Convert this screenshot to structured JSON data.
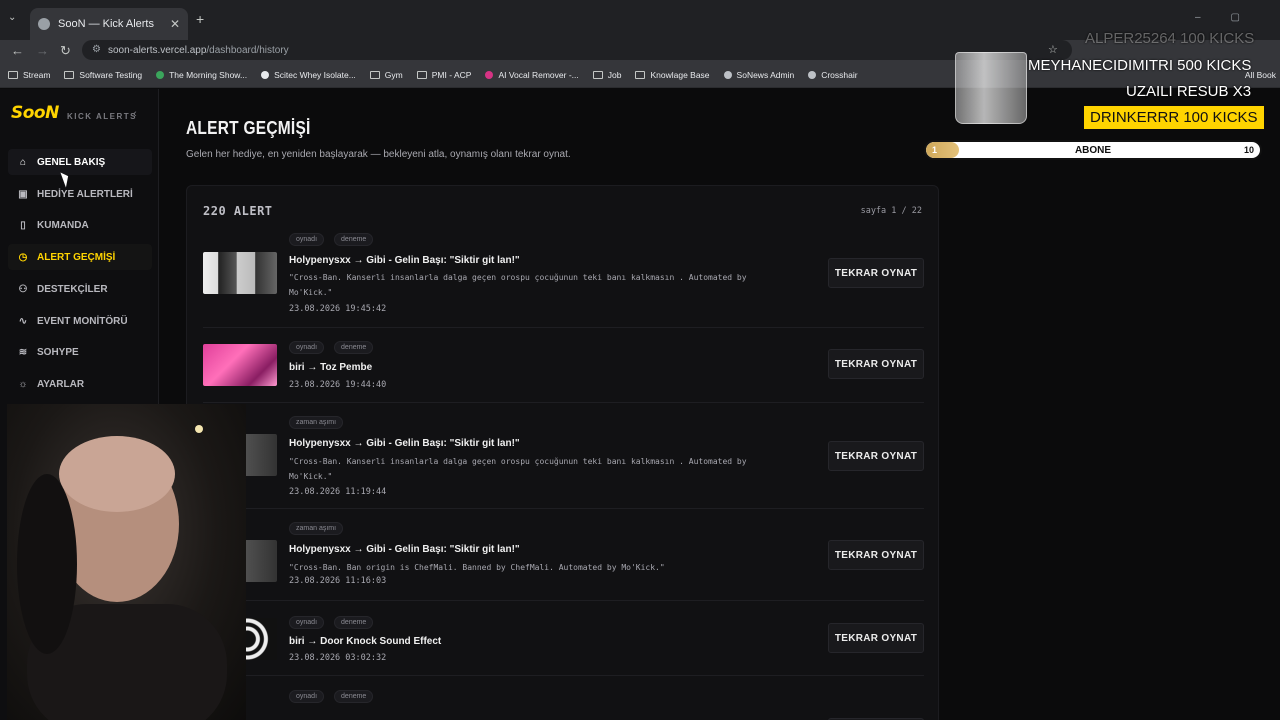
{
  "browser": {
    "tab_title": "SooN — Kick Alerts",
    "url_host": "soon-alerts.vercel.app",
    "url_path": "/dashboard/history",
    "bookmarks": [
      "Stream",
      "Software Testing",
      "The Morning Show...",
      "Scitec Whey Isolate...",
      "Gym",
      "PMI - ACP",
      "AI Vocal Remover -...",
      "Job",
      "Knowlage Base",
      "SoNews Admin",
      "Crosshair"
    ],
    "all_bookmarks": "All Book"
  },
  "sidebar": {
    "logo": "SooN",
    "logo_sub": "KICK ALERTS",
    "items": [
      {
        "label": "GENEL BAKIŞ",
        "icon": "home-icon"
      },
      {
        "label": "HEDİYE ALERTLERİ",
        "icon": "gift-icon"
      },
      {
        "label": "KUMANDA",
        "icon": "remote-icon"
      },
      {
        "label": "ALERT GEÇMİŞİ",
        "icon": "history-icon"
      },
      {
        "label": "DESTEKÇİLER",
        "icon": "supporters-icon"
      },
      {
        "label": "EVENT MONİTÖRÜ",
        "icon": "pulse-icon"
      },
      {
        "label": "SOHYPE",
        "icon": "layers-icon"
      },
      {
        "label": "AYARLAR",
        "icon": "gear-icon"
      }
    ]
  },
  "page": {
    "title": "ALERT GEÇMİŞİ",
    "subtitle": "Gelen her hediye, en yeniden başlayarak — bekleyeni atla, oynamış olanı tekrar oynat.",
    "count": "220 ALERT",
    "pagination": "sayfa 1 / 22",
    "replay_label": "TEKRAR OYNAT"
  },
  "alerts": [
    {
      "tags": [
        "oynadı",
        "deneme"
      ],
      "title": "Holypenysxx → Gibi - Gelin Başı: \"Siktir git lan!\"",
      "message": "\"Cross-Ban. Kanserli insanlarla dalga geçen orospu çocuğunun teki banı kalkmasın . Automated by Mo'Kick.\"",
      "time": "23.08.2026 19:45:42"
    },
    {
      "tags": [
        "oynadı",
        "deneme"
      ],
      "title": "biri → Toz Pembe",
      "message": "",
      "time": "23.08.2026 19:44:40"
    },
    {
      "tags": [
        "zaman aşımı"
      ],
      "title": "Holypenysxx → Gibi - Gelin Başı: \"Siktir git lan!\"",
      "message": "\"Cross-Ban. Kanserli insanlarla dalga geçen orospu çocuğunun teki banı kalkmasın . Automated by Mo'Kick.\"",
      "time": "23.08.2026 11:19:44"
    },
    {
      "tags": [
        "zaman aşımı"
      ],
      "title": "Holypenysxx → Gibi - Gelin Başı: \"Siktir git lan!\"",
      "message": "\"Cross-Ban. Ban origin is ChefMali. Banned by ChefMali. Automated by Mo'Kick.\"",
      "time": "23.08.2026 11:16:03"
    },
    {
      "tags": [
        "oynadı",
        "deneme"
      ],
      "title": "biri → Door Knock Sound Effect",
      "message": "",
      "time": "23.08.2026 03:02:32"
    },
    {
      "tags": [
        "oynadı",
        "deneme"
      ],
      "title": "",
      "message": "",
      "time": ""
    }
  ],
  "overlay": {
    "faded_line": "ALPER25264  100 KICKS",
    "line1": "MEYHANECIDIMITRI  500 KICKS",
    "line2": "UZAILI  RESUB X3",
    "highlight": "DRINKERRR  100 KICKS",
    "sub_label": "ABONE",
    "sub_current": "1",
    "sub_goal": "10",
    "sub_progress": 0.1
  },
  "colors": {
    "accent": "#ffd400",
    "background": "#0b0b0c"
  }
}
